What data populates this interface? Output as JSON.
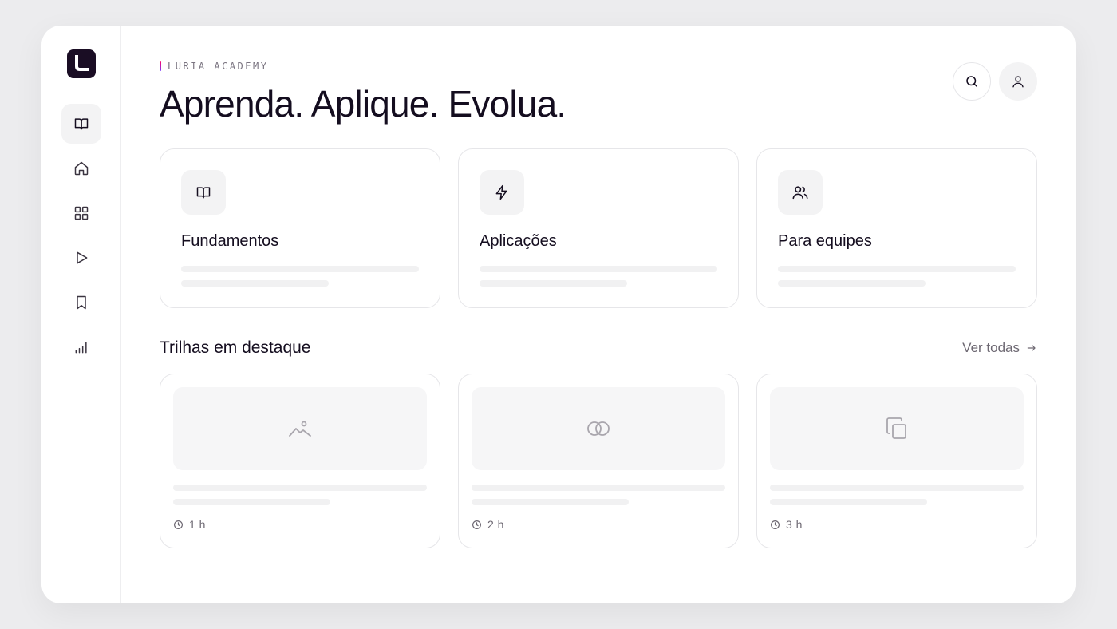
{
  "brand": {
    "eyebrow": "LURIA ACADEMY",
    "logo_letter": "L"
  },
  "header": {
    "headline": "Aprenda. Aplique. Evolua."
  },
  "sidebar": {
    "items": [
      {
        "icon": "book-open-icon",
        "active": true
      },
      {
        "icon": "home-icon",
        "active": false
      },
      {
        "icon": "grid-icon",
        "active": false
      },
      {
        "icon": "play-icon",
        "active": false
      },
      {
        "icon": "bookmark-icon",
        "active": false
      },
      {
        "icon": "bar-chart-icon",
        "active": false
      }
    ]
  },
  "categories": [
    {
      "title": "Fundamentos",
      "icon": "book-open-icon"
    },
    {
      "title": "Aplicações",
      "icon": "lightning-icon"
    },
    {
      "title": "Para equipes",
      "icon": "users-icon"
    }
  ],
  "featured": {
    "title": "Trilhas em destaque",
    "see_all": "Ver todas",
    "tracks": [
      {
        "duration": "1 h",
        "icon": "image-icon"
      },
      {
        "duration": "2 h",
        "icon": "rings-icon"
      },
      {
        "duration": "3 h",
        "icon": "copy-icon"
      }
    ]
  },
  "colors": {
    "ink": "#140d1f",
    "logo_bg": "#1a0d24",
    "muted": "#6d6872",
    "border": "#e6e6e9",
    "skeleton": "#f1f1f2"
  }
}
